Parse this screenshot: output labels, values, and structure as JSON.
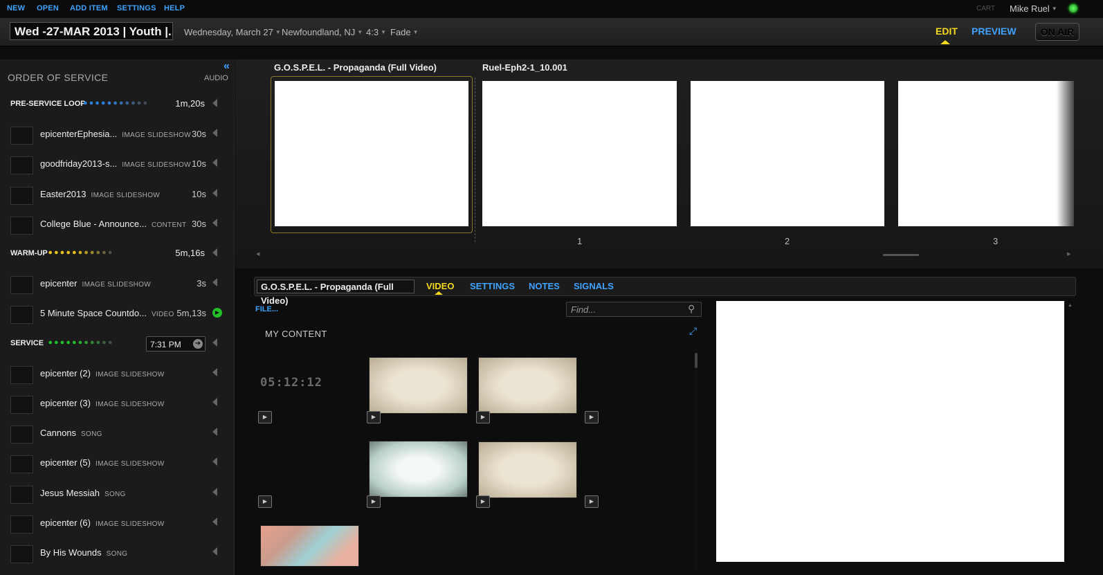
{
  "menu": {
    "new": "NEW",
    "open": "OPEN",
    "add_item": "ADD ITEM",
    "settings": "SETTINGS",
    "help": "HELP",
    "cart": "CART",
    "user": "Mike Ruel"
  },
  "header": {
    "title": "Wed -27-MAR 2013 | Youth |...",
    "date": "Wednesday, March 27",
    "location": "Newfoundland, NJ",
    "aspect": "4:3",
    "transition": "Fade",
    "edit": "EDIT",
    "preview": "PREVIEW",
    "on_air": "ON AIR"
  },
  "sidebar": {
    "title": "ORDER OF SERVICE",
    "audio": "AUDIO",
    "rows": [
      {
        "kind": "section",
        "label": "PRE-SERVICE LOOP",
        "duration": "1m,20s",
        "dot_color": "#2f7fd8"
      },
      {
        "kind": "item",
        "name": "epicenterEphesia...",
        "type": "IMAGE SLIDESHOW",
        "duration": "30s"
      },
      {
        "kind": "item",
        "name": "goodfriday2013-s...",
        "type": "IMAGE SLIDESHOW",
        "duration": "10s"
      },
      {
        "kind": "item",
        "name": "Easter2013",
        "type": "IMAGE SLIDESHOW",
        "duration": "10s"
      },
      {
        "kind": "item",
        "name": "College Blue - Announce...",
        "type": "CONTENT",
        "duration": "30s"
      },
      {
        "kind": "section",
        "label": "WARM-UP",
        "duration": "5m,16s",
        "dot_color": "#e8c21a"
      },
      {
        "kind": "item",
        "name": "epicenter",
        "type": "IMAGE SLIDESHOW",
        "duration": "3s"
      },
      {
        "kind": "item",
        "name": "5 Minute Space Countdo...",
        "type": "VIDEO",
        "duration": "5m,13s",
        "playing": true
      },
      {
        "kind": "section",
        "label": "SERVICE",
        "time": "7:31 PM",
        "dot_color": "#21c12b"
      },
      {
        "kind": "item",
        "name": "epicenter (2)",
        "type": "IMAGE SLIDESHOW",
        "duration": ""
      },
      {
        "kind": "item",
        "name": "epicenter (3)",
        "type": "IMAGE SLIDESHOW",
        "duration": ""
      },
      {
        "kind": "item",
        "name": "Cannons",
        "type": "SONG",
        "duration": ""
      },
      {
        "kind": "item",
        "name": "epicenter (5)",
        "type": "IMAGE SLIDESHOW",
        "duration": ""
      },
      {
        "kind": "item",
        "name": "Jesus Messiah",
        "type": "SONG",
        "duration": ""
      },
      {
        "kind": "item",
        "name": "epicenter (6)",
        "type": "IMAGE SLIDESHOW",
        "duration": ""
      },
      {
        "kind": "item",
        "name": "By His Wounds",
        "type": "SONG",
        "duration": ""
      }
    ]
  },
  "slides": {
    "title_1": "G.O.S.P.E.L. - Propaganda (Full Video)",
    "title_2": "Ruel-Eph2-1_10.001",
    "numbers": [
      "1",
      "2",
      "3"
    ]
  },
  "editor": {
    "item_name": "G.O.S.P.E.L. - Propaganda (Full Video)",
    "tabs": [
      "VIDEO",
      "SETTINGS",
      "NOTES",
      "SIGNALS"
    ],
    "file_link": "FILE...",
    "find_placeholder": "Find...",
    "my_content": "MY CONTENT",
    "countdown_text": "05:12:12"
  },
  "colors": {
    "accent_blue": "#3fa3ff",
    "accent_yellow": "#f5d91c",
    "play_green": "#22c12a"
  }
}
